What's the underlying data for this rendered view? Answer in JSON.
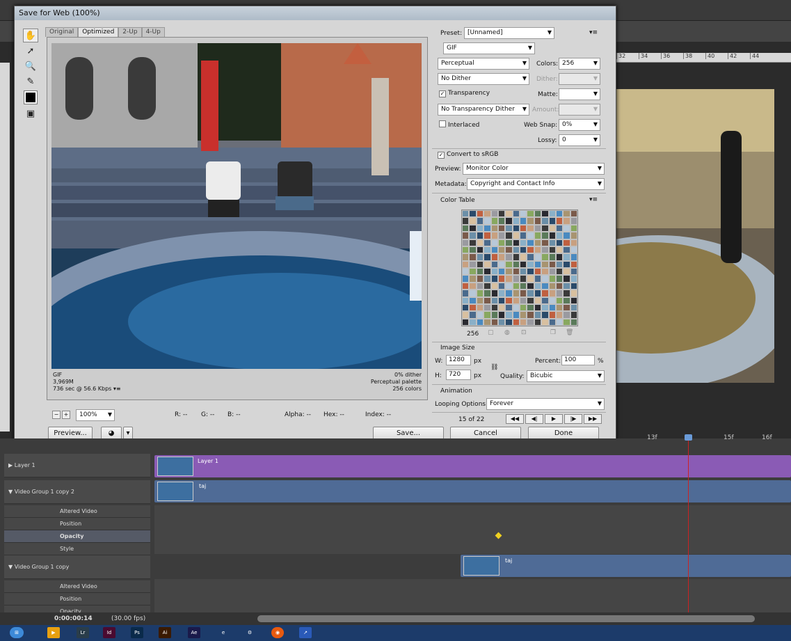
{
  "dialog": {
    "title": "Save for Web (100%)",
    "tabs": [
      "Original",
      "Optimized",
      "2-Up",
      "4-Up"
    ],
    "active_tab": "Optimized",
    "preview_info_left": [
      "GIF",
      "3,969M",
      "736 sec @ 56.6 Kbps"
    ],
    "preview_info_right": [
      "0% dither",
      "Perceptual palette",
      "256 colors"
    ],
    "zoom": "100%",
    "readouts": {
      "r": "R: --",
      "g": "G: --",
      "b": "B: --",
      "alpha": "Alpha: --",
      "hex": "Hex: --",
      "index": "Index: --"
    },
    "buttons": {
      "preview": "Preview...",
      "save": "Save...",
      "cancel": "Cancel",
      "done": "Done"
    }
  },
  "settings": {
    "preset_label": "Preset:",
    "preset_value": "[Unnamed]",
    "format": "GIF",
    "reduction": "Perceptual",
    "colors_label": "Colors:",
    "colors_value": "256",
    "dither_method": "No Dither",
    "dither_label": "Dither:",
    "transparency_label": "Transparency",
    "matte_label": "Matte:",
    "transparency_dither": "No Transparency Dither",
    "amount_label": "Amount:",
    "interlaced_label": "Interlaced",
    "websnap_label": "Web Snap:",
    "websnap_value": "0%",
    "lossy_label": "Lossy:",
    "lossy_value": "0",
    "convert_srgb_label": "Convert to sRGB",
    "preview_label": "Preview:",
    "preview_value": "Monitor Color",
    "metadata_label": "Metadata:",
    "metadata_value": "Copyright and Contact Info"
  },
  "color_table": {
    "title": "Color Table",
    "count": "256"
  },
  "image_size": {
    "title": "Image Size",
    "w_label": "W:",
    "w_value": "1280",
    "h_label": "H:",
    "h_value": "720",
    "unit": "px",
    "percent_label": "Percent:",
    "percent_value": "100",
    "percent_unit": "%",
    "quality_label": "Quality:",
    "quality_value": "Bicubic"
  },
  "animation": {
    "title": "Animation",
    "looping_label": "Looping Options:",
    "looping_value": "Forever",
    "frame": "15 of 22"
  },
  "ruler_ticks": [
    "32",
    "34",
    "36",
    "38",
    "40",
    "42",
    "44"
  ],
  "timeline": {
    "layers": [
      {
        "name": "Layer 1"
      },
      {
        "name": "Video Group 1 copy 2"
      },
      {
        "name": "Altered Video"
      },
      {
        "name": "Position"
      },
      {
        "name": "Opacity"
      },
      {
        "name": "Style"
      },
      {
        "name": "Video Group 1 copy"
      },
      {
        "name": "Altered Video"
      },
      {
        "name": "Position"
      },
      {
        "name": "Opacity"
      }
    ],
    "clip_labels": [
      "Layer 1",
      "taj",
      "taj"
    ],
    "frame_ticks": [
      "13f",
      "15f",
      "16f"
    ],
    "timecode": "0:00:00:14",
    "fps": "(30.00 fps)"
  },
  "taskbar": {
    "items": [
      "Lr",
      "Id",
      "Ps",
      "Ai",
      "Ae"
    ]
  },
  "colors": {
    "purple_track": "#8a5bb5",
    "blue_track": "#4f6b96",
    "accent": "#3a6ea5"
  }
}
